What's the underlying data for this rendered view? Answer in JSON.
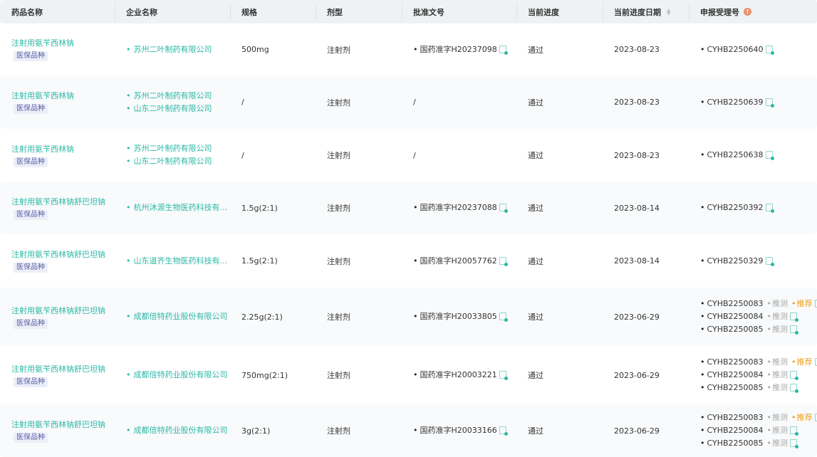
{
  "headers": [
    "药品名称",
    "企业名称",
    "规格",
    "剂型",
    "批准文号",
    "当前进度",
    "当前进度日期",
    "申报受理号"
  ],
  "tag_label": "医保品种",
  "infer_label": "推测",
  "rec_label": "推荐",
  "rows": [
    {
      "drug": "注射用氨苄西林钠",
      "companies": [
        "苏州二叶制药有限公司"
      ],
      "spec": "500mg",
      "form": "注射剂",
      "approval": "国药准字H20237098",
      "progress": "通过",
      "date": "2023-08-23",
      "accept": [
        {
          "no": "CYHB2250640"
        }
      ]
    },
    {
      "drug": "注射用氨苄西林钠",
      "companies": [
        "苏州二叶制药有限公司",
        "山东二叶制药有限公司"
      ],
      "spec": "/",
      "form": "注射剂",
      "approval": "/",
      "progress": "通过",
      "date": "2023-08-23",
      "accept": [
        {
          "no": "CYHB2250639"
        }
      ]
    },
    {
      "drug": "注射用氨苄西林钠",
      "companies": [
        "苏州二叶制药有限公司",
        "山东二叶制药有限公司"
      ],
      "spec": "/",
      "form": "注射剂",
      "approval": "/",
      "progress": "通过",
      "date": "2023-08-23",
      "accept": [
        {
          "no": "CYHB2250638"
        }
      ]
    },
    {
      "drug": "注射用氨苄西林钠舒巴坦钠",
      "companies": [
        "杭州沐源生物医药科技有..."
      ],
      "spec": "1.5g(2:1)",
      "form": "注射剂",
      "approval": "国药准字H20237088",
      "progress": "通过",
      "date": "2023-08-14",
      "accept": [
        {
          "no": "CYHB2250392"
        }
      ]
    },
    {
      "drug": "注射用氨苄西林钠舒巴坦钠",
      "companies": [
        "山东道齐生物医药科技有..."
      ],
      "spec": "1.5g(2:1)",
      "form": "注射剂",
      "approval": "国药准字H20057762",
      "progress": "通过",
      "date": "2023-08-14",
      "accept": [
        {
          "no": "CYHB2250329"
        }
      ]
    },
    {
      "drug": "注射用氨苄西林钠舒巴坦钠",
      "companies": [
        "成都倍特药业股份有限公司"
      ],
      "spec": "2.25g(2:1)",
      "form": "注射剂",
      "approval": "国药准字H20033805",
      "progress": "通过",
      "date": "2023-06-29",
      "accept": [
        {
          "no": "CYHB2250083",
          "infer": true,
          "rec": true
        },
        {
          "no": "CYHB2250084",
          "infer": true
        },
        {
          "no": "CYHB2250085",
          "infer": true
        }
      ]
    },
    {
      "drug": "注射用氨苄西林钠舒巴坦钠",
      "companies": [
        "成都倍特药业股份有限公司"
      ],
      "spec": "750mg(2:1)",
      "form": "注射剂",
      "approval": "国药准字H20003221",
      "progress": "通过",
      "date": "2023-06-29",
      "accept": [
        {
          "no": "CYHB2250083",
          "infer": true,
          "rec": true
        },
        {
          "no": "CYHB2250084",
          "infer": true
        },
        {
          "no": "CYHB2250085",
          "infer": true
        }
      ]
    },
    {
      "drug": "注射用氨苄西林钠舒巴坦钠",
      "companies": [
        "成都倍特药业股份有限公司"
      ],
      "spec": "3g(2:1)",
      "form": "注射剂",
      "approval": "国药准字H20033166",
      "progress": "通过",
      "date": "2023-06-29",
      "accept": [
        {
          "no": "CYHB2250083",
          "infer": true,
          "rec": true
        },
        {
          "no": "CYHB2250084",
          "infer": true
        },
        {
          "no": "CYHB2250085",
          "infer": true
        }
      ]
    }
  ]
}
